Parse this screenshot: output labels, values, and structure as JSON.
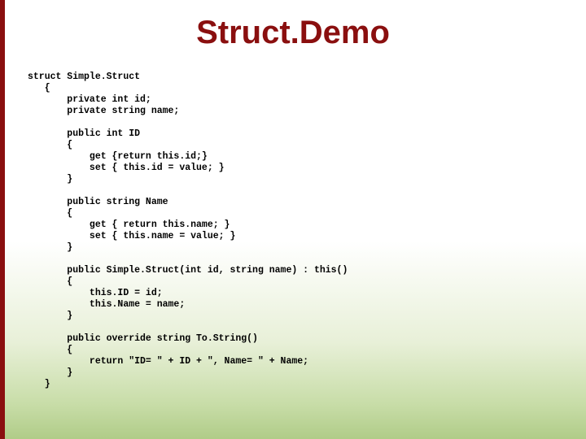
{
  "title": "Struct.Demo",
  "code_lines": [
    "struct Simple.Struct",
    "   {",
    "       private int id;",
    "       private string name;",
    "",
    "       public int ID",
    "       {",
    "           get {return this.id;}",
    "           set { this.id = value; }",
    "       }",
    "",
    "       public string Name",
    "       {",
    "           get { return this.name; }",
    "           set { this.name = value; }",
    "       }",
    "",
    "       public Simple.Struct(int id, string name) : this()",
    "       {",
    "           this.ID = id;",
    "           this.Name = name;",
    "       }",
    "",
    "       public override string To.String()",
    "       {",
    "           return \"ID= \" + ID + \", Name= \" + Name;",
    "       }",
    "   }"
  ]
}
